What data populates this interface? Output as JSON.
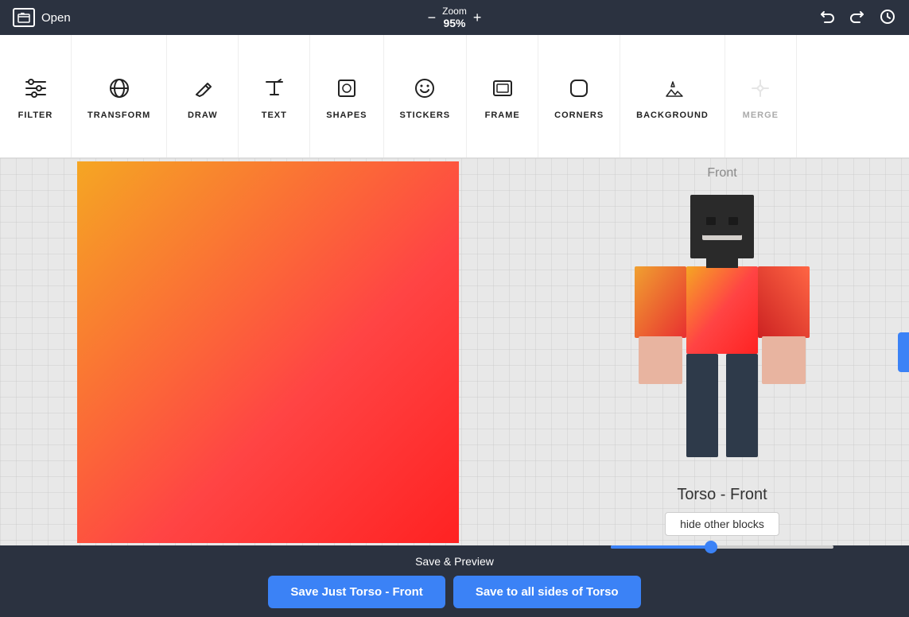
{
  "topbar": {
    "open_label": "Open",
    "zoom_label": "Zoom",
    "zoom_value": "95%",
    "zoom_minus": "−",
    "zoom_plus": "+"
  },
  "toolbar": {
    "items": [
      {
        "id": "filter",
        "label": "FILTER",
        "icon": "filter-icon",
        "disabled": false
      },
      {
        "id": "transform",
        "label": "TRANSFORM",
        "icon": "transform-icon",
        "disabled": false
      },
      {
        "id": "draw",
        "label": "DRAW",
        "icon": "draw-icon",
        "disabled": false
      },
      {
        "id": "text",
        "label": "TEXT",
        "icon": "text-icon",
        "disabled": false
      },
      {
        "id": "shapes",
        "label": "SHAPES",
        "icon": "shapes-icon",
        "disabled": false
      },
      {
        "id": "stickers",
        "label": "STICKERS",
        "icon": "stickers-icon",
        "disabled": false
      },
      {
        "id": "frame",
        "label": "FRAME",
        "icon": "frame-icon",
        "disabled": false
      },
      {
        "id": "corners",
        "label": "CORNERS",
        "icon": "corners-icon",
        "disabled": false
      },
      {
        "id": "background",
        "label": "BACKGROUND",
        "icon": "background-icon",
        "disabled": false
      },
      {
        "id": "merge",
        "label": "MERGE",
        "icon": "merge-icon",
        "disabled": true
      }
    ]
  },
  "preview": {
    "view_label": "Front",
    "part_label": "Torso - Front",
    "hide_blocks_label": "hide other blocks"
  },
  "bottom": {
    "save_preview_label": "Save & Preview",
    "save_just_label": "Save Just Torso - Front",
    "save_all_label": "Save to all sides of Torso"
  }
}
